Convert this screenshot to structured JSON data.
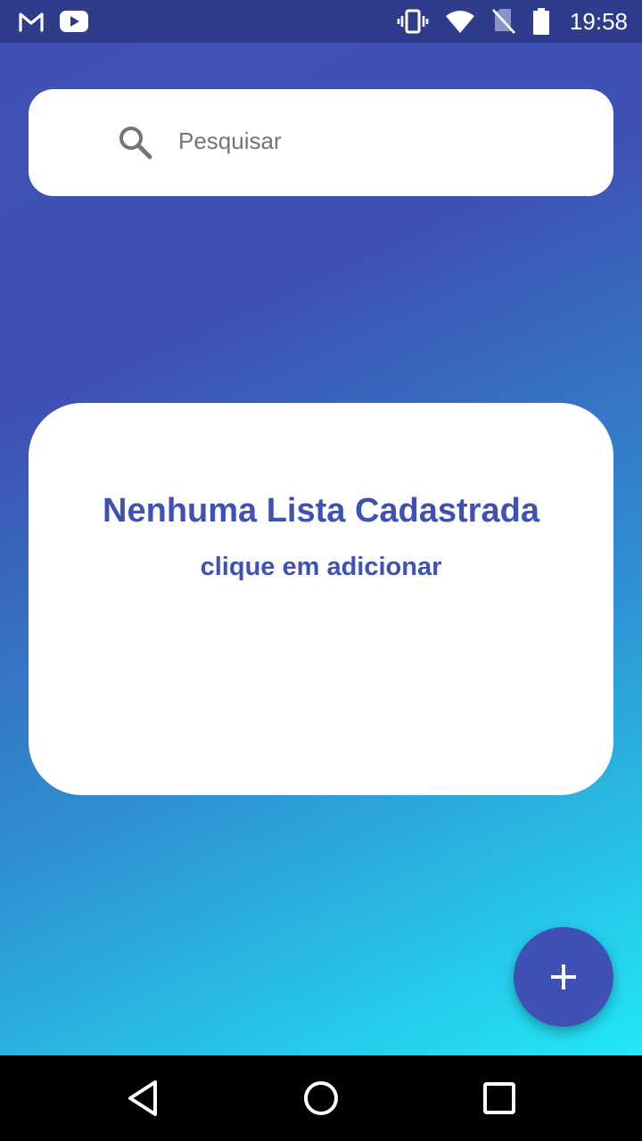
{
  "status_bar": {
    "time": "19:58",
    "left_icons": [
      "gmail-icon",
      "youtube-icon"
    ],
    "right_icons": [
      "vibrate-icon",
      "wifi-icon",
      "no-sim-icon",
      "battery-icon"
    ]
  },
  "search": {
    "placeholder": "Pesquisar",
    "value": "",
    "icon": "search-icon"
  },
  "empty_state": {
    "title": "Nenhuma Lista Cadastrada",
    "subtitle": "clique em adicionar"
  },
  "fab": {
    "icon": "plus-icon"
  },
  "nav_bar": {
    "buttons": [
      "back-icon",
      "home-icon",
      "recents-icon"
    ]
  },
  "colors": {
    "primary": "#3f51b5",
    "status_bar": "#2f3c8c",
    "gradient_start": "#3f51b5",
    "gradient_end": "#1ff7fe",
    "card": "#ffffff"
  }
}
